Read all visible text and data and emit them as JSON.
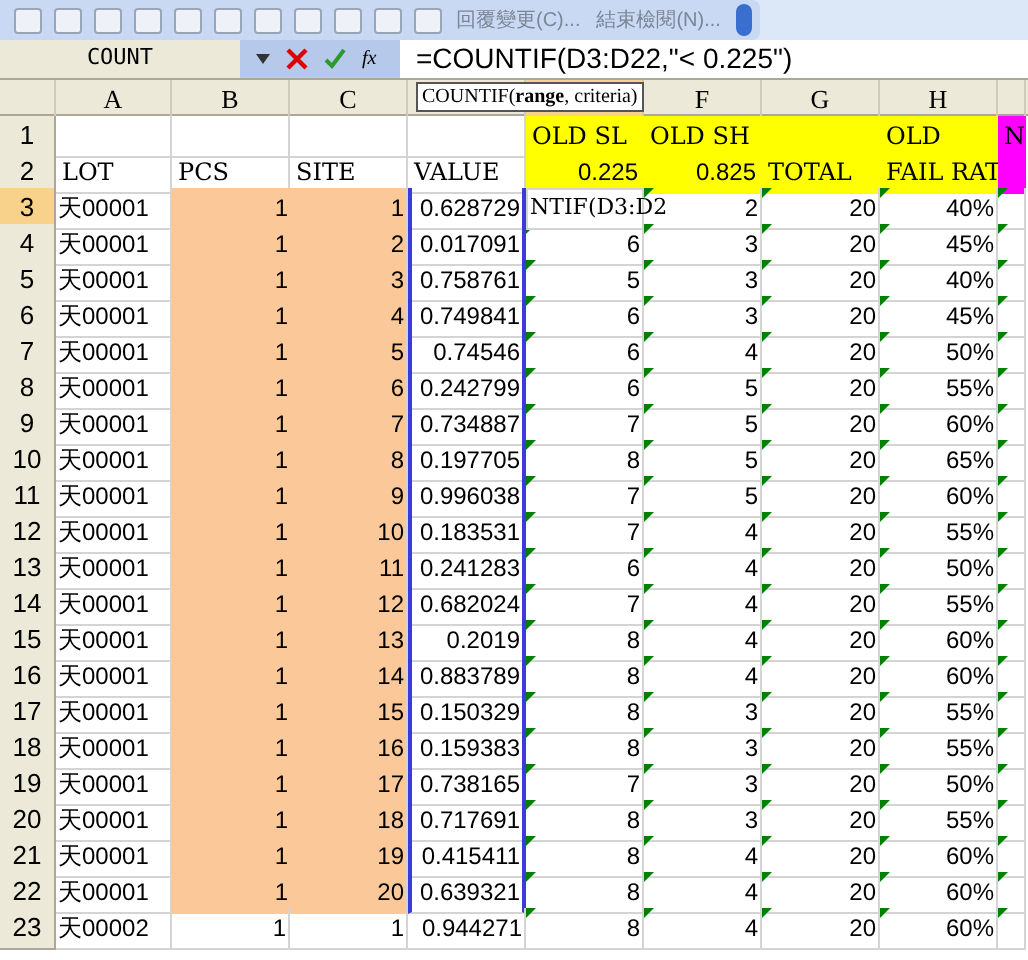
{
  "toolbar": {
    "review_buttons": [
      "回覆變更(C)...",
      "結束檢閱(N)..."
    ]
  },
  "formula_bar": {
    "name_box": "COUNT",
    "function_button": "fx",
    "formula": "=COUNTIF(D3:D22,\"< 0.225\")"
  },
  "tooltip": {
    "text": "COUNTIF(**range**, criteria)"
  },
  "columns": [
    {
      "label": "A"
    },
    {
      "label": "B"
    },
    {
      "label": "C"
    },
    {},
    {},
    {
      "label": "F"
    },
    {
      "label": "G"
    },
    {
      "label": "H"
    },
    {}
  ],
  "header_rows": [
    {
      "header": "1",
      "cells": [
        {},
        {},
        {},
        {},
        {
          "text": "OLD SL",
          "kind": "text",
          "color": "#ffff00"
        },
        {
          "text": "OLD SH",
          "kind": "text",
          "color": "#ffff00"
        },
        {
          "color": "#ffff00"
        },
        {
          "text": "OLD",
          "kind": "text",
          "color": "#ffff00"
        },
        {
          "text": "N",
          "kind": "text",
          "color": "#ff00ff"
        }
      ]
    },
    {
      "header": "2",
      "cells": [
        {
          "text": "LOT",
          "kind": "text"
        },
        {
          "text": "PCS",
          "kind": "text"
        },
        {
          "text": "SITE",
          "kind": "text"
        },
        {
          "text": "VALUE",
          "kind": "text"
        },
        {
          "text": "0.225",
          "kind": "number",
          "color": "#ffff00"
        },
        {
          "text": "0.825",
          "kind": "number",
          "color": "#ffff00"
        },
        {
          "text": "TOTAL",
          "kind": "text",
          "color": "#ffff00"
        },
        {
          "text": "FAIL RAT",
          "kind": "text",
          "color": "#ffff00"
        },
        {
          "color": "#ff00ff"
        }
      ]
    }
  ],
  "rows": [
    {
      "header": "3",
      "cells": [
        "天00001",
        "1",
        "1",
        "0.628729",
        "NTIF(D3:D2",
        "2",
        "20",
        "40%"
      ],
      "color": "#fbc999",
      "editing": true,
      "in_range": true,
      "error_marks": true
    },
    {
      "header": "4",
      "cells": [
        "天00001",
        "1",
        "2",
        "0.017091",
        "6",
        "3",
        "20",
        "45%"
      ],
      "color": "#fbc999",
      "editing": false,
      "in_range": true,
      "error_marks": true
    },
    {
      "header": "5",
      "cells": [
        "天00001",
        "1",
        "3",
        "0.758761",
        "5",
        "3",
        "20",
        "40%"
      ],
      "color": "#fbc999",
      "editing": false,
      "in_range": true,
      "error_marks": true
    },
    {
      "header": "6",
      "cells": [
        "天00001",
        "1",
        "4",
        "0.749841",
        "6",
        "3",
        "20",
        "45%"
      ],
      "color": "#fbc999",
      "editing": false,
      "in_range": true,
      "error_marks": true
    },
    {
      "header": "7",
      "cells": [
        "天00001",
        "1",
        "5",
        "0.74546",
        "6",
        "4",
        "20",
        "50%"
      ],
      "color": "#fbc999",
      "editing": false,
      "in_range": true,
      "error_marks": true
    },
    {
      "header": "8",
      "cells": [
        "天00001",
        "1",
        "6",
        "0.242799",
        "6",
        "5",
        "20",
        "55%"
      ],
      "color": "#fbc999",
      "editing": false,
      "in_range": true,
      "error_marks": true
    },
    {
      "header": "9",
      "cells": [
        "天00001",
        "1",
        "7",
        "0.734887",
        "7",
        "5",
        "20",
        "60%"
      ],
      "color": "#fbc999",
      "editing": false,
      "in_range": true,
      "error_marks": true
    },
    {
      "header": "10",
      "cells": [
        "天00001",
        "1",
        "8",
        "0.197705",
        "8",
        "5",
        "20",
        "65%"
      ],
      "color": "#fbc999",
      "editing": false,
      "in_range": true,
      "error_marks": true
    },
    {
      "header": "11",
      "cells": [
        "天00001",
        "1",
        "9",
        "0.996038",
        "7",
        "5",
        "20",
        "60%"
      ],
      "color": "#fbc999",
      "editing": false,
      "in_range": true,
      "error_marks": true
    },
    {
      "header": "12",
      "cells": [
        "天00001",
        "1",
        "10",
        "0.183531",
        "7",
        "4",
        "20",
        "55%"
      ],
      "color": "#fbc999",
      "editing": false,
      "in_range": true,
      "error_marks": true
    },
    {
      "header": "13",
      "cells": [
        "天00001",
        "1",
        "11",
        "0.241283",
        "6",
        "4",
        "20",
        "50%"
      ],
      "color": "#fbc999",
      "editing": false,
      "in_range": true,
      "error_marks": true
    },
    {
      "header": "14",
      "cells": [
        "天00001",
        "1",
        "12",
        "0.682024",
        "7",
        "4",
        "20",
        "55%"
      ],
      "color": "#fbc999",
      "editing": false,
      "in_range": true,
      "error_marks": true
    },
    {
      "header": "15",
      "cells": [
        "天00001",
        "1",
        "13",
        "0.2019",
        "8",
        "4",
        "20",
        "60%"
      ],
      "color": "#fbc999",
      "editing": false,
      "in_range": true,
      "error_marks": true
    },
    {
      "header": "16",
      "cells": [
        "天00001",
        "1",
        "14",
        "0.883789",
        "8",
        "4",
        "20",
        "60%"
      ],
      "color": "#fbc999",
      "editing": false,
      "in_range": true,
      "error_marks": true
    },
    {
      "header": "17",
      "cells": [
        "天00001",
        "1",
        "15",
        "0.150329",
        "8",
        "3",
        "20",
        "55%"
      ],
      "color": "#fbc999",
      "editing": false,
      "in_range": true,
      "error_marks": true
    },
    {
      "header": "18",
      "cells": [
        "天00001",
        "1",
        "16",
        "0.159383",
        "8",
        "3",
        "20",
        "55%"
      ],
      "color": "#fbc999",
      "editing": false,
      "in_range": true,
      "error_marks": true
    },
    {
      "header": "19",
      "cells": [
        "天00001",
        "1",
        "17",
        "0.738165",
        "7",
        "3",
        "20",
        "50%"
      ],
      "color": "#fbc999",
      "editing": false,
      "in_range": true,
      "error_marks": true
    },
    {
      "header": "20",
      "cells": [
        "天00001",
        "1",
        "18",
        "0.717691",
        "8",
        "3",
        "20",
        "55%"
      ],
      "color": "#fbc999",
      "editing": false,
      "in_range": true,
      "error_marks": true
    },
    {
      "header": "21",
      "cells": [
        "天00001",
        "1",
        "19",
        "0.415411",
        "8",
        "4",
        "20",
        "60%"
      ],
      "color": "#fbc999",
      "editing": false,
      "in_range": true,
      "error_marks": true
    },
    {
      "header": "22",
      "cells": [
        "天00001",
        "1",
        "20",
        "0.639321",
        "8",
        "4",
        "20",
        "60%"
      ],
      "color": "#fbc999",
      "editing": false,
      "in_range": true,
      "error_marks": true
    },
    {
      "header": "23",
      "cells": [
        "天00002",
        "1",
        "1",
        "0.944271",
        "8",
        "4",
        "20",
        "60%"
      ],
      "editing": false,
      "in_range": false,
      "error_marks": true
    }
  ]
}
